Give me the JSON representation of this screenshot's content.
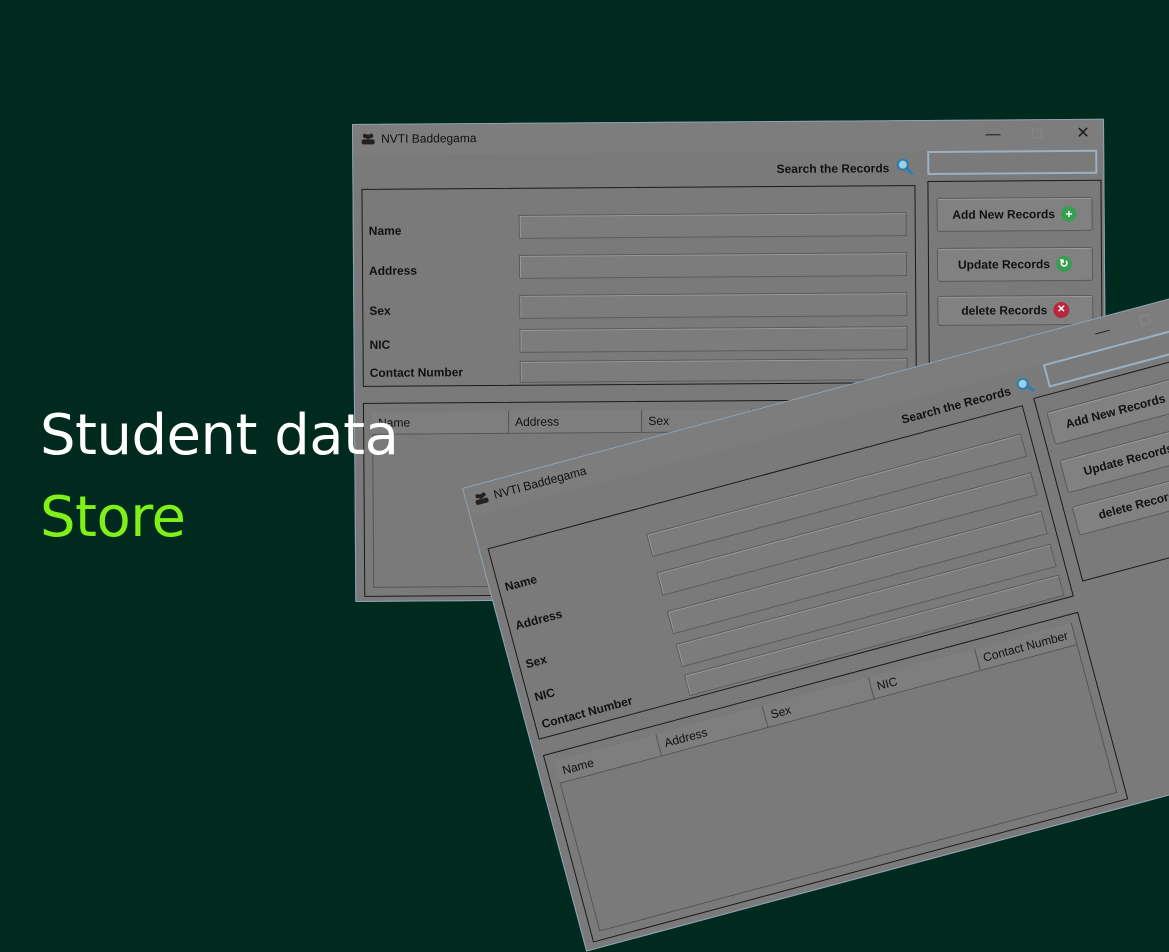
{
  "hero": {
    "line1": "Student data",
    "line2": "Store"
  },
  "colors": {
    "background": "#012a1f",
    "accent": "#7ff018",
    "window": "#7a7a7a"
  },
  "window": {
    "title": "NVTI Baddegama",
    "icon": "users-icon",
    "controls": {
      "minimize": "—",
      "maximize": "☐",
      "close": "✕"
    },
    "search": {
      "label": "Search the Records",
      "icon": "search-icon",
      "value": ""
    },
    "fields": [
      {
        "label": "Name",
        "value": ""
      },
      {
        "label": "Address",
        "value": ""
      },
      {
        "label": "Sex",
        "value": ""
      },
      {
        "label": "NIC",
        "value": ""
      },
      {
        "label": "Contact Number",
        "value": ""
      }
    ],
    "buttons": {
      "add": {
        "label": "Add New Records",
        "icon": "plus-circle-icon",
        "glyph": "+"
      },
      "update": {
        "label": "Update Records",
        "icon": "refresh-icon",
        "glyph": "↻"
      },
      "delete": {
        "label": "delete Records",
        "icon": "delete-circle-icon",
        "glyph": "✕"
      }
    },
    "table_columns": [
      "Name",
      "Address",
      "Sex",
      "NIC",
      "Contact Number"
    ]
  }
}
